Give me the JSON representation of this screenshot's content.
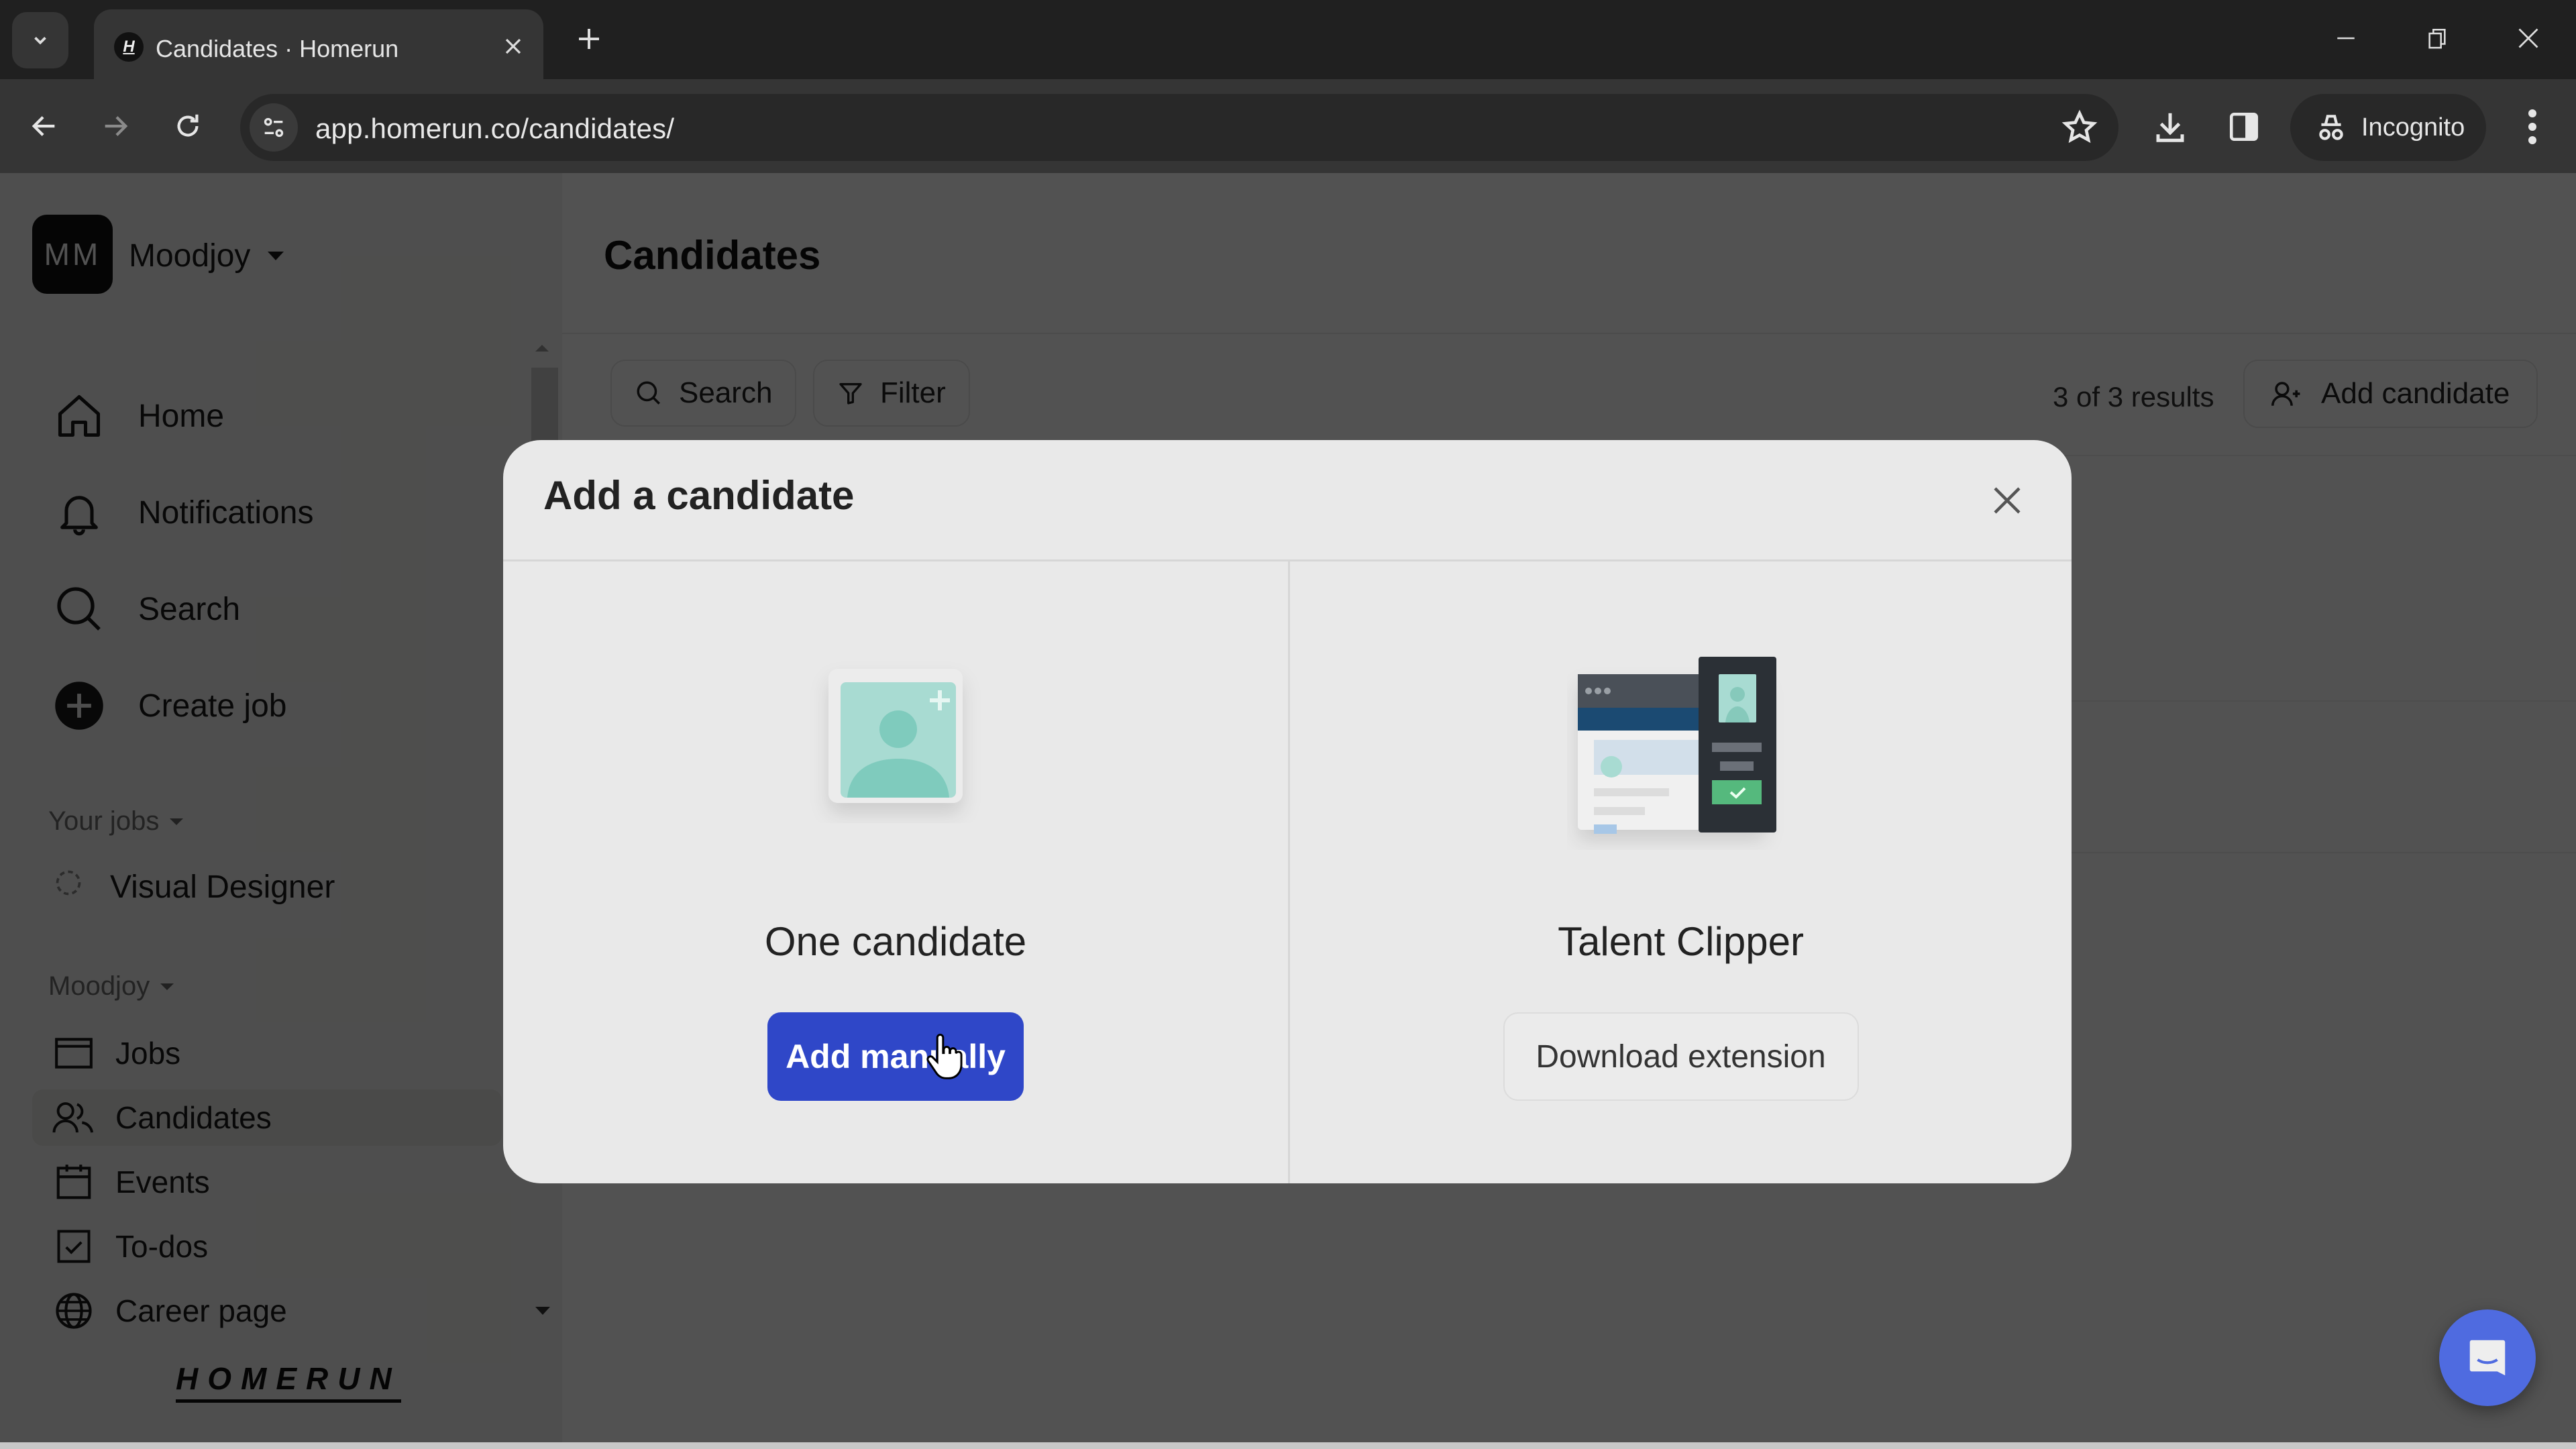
{
  "browser": {
    "tab_title": "Candidates · Homerun",
    "tab_favicon_letter": "H",
    "url": "app.homerun.co/candidates/",
    "incognito_label": "Incognito"
  },
  "sidebar": {
    "workspace_initials": "MM",
    "workspace_name": "Moodjoy",
    "main_nav": [
      {
        "label": "Home",
        "icon": "home-icon"
      },
      {
        "label": "Notifications",
        "icon": "bell-icon"
      },
      {
        "label": "Search",
        "icon": "search-icon"
      },
      {
        "label": "Create job",
        "icon": "plus-circle-icon"
      }
    ],
    "your_jobs_label": "Your jobs",
    "jobs": [
      {
        "label": "Visual Designer",
        "icon": "dashed-circle-icon"
      }
    ],
    "org_section_label": "Moodjoy",
    "org_nav": [
      {
        "label": "Jobs",
        "icon": "card-icon",
        "active": false
      },
      {
        "label": "Candidates",
        "icon": "users-icon",
        "active": true
      },
      {
        "label": "Events",
        "icon": "calendar-icon",
        "active": false
      },
      {
        "label": "To-dos",
        "icon": "checkbox-icon",
        "active": false
      },
      {
        "label": "Career page",
        "icon": "globe-icon",
        "active": false
      }
    ],
    "brand": "HOMERUN"
  },
  "main": {
    "page_title": "Candidates",
    "search_label": "Search",
    "filter_label": "Filter",
    "results_text": "3 of 3 results",
    "add_candidate_label": "Add candidate"
  },
  "modal": {
    "title": "Add a candidate",
    "options": [
      {
        "title": "One candidate",
        "button_label": "Add manually",
        "button_style": "primary"
      },
      {
        "title": "Talent Clipper",
        "button_label": "Download extension",
        "button_style": "secondary"
      }
    ]
  },
  "colors": {
    "primary_button": "#2f47c8",
    "chat_fab": "#4f6be0",
    "illustration_teal": "#7fcbbd",
    "illustration_navy": "#1b4a72",
    "illustration_green": "#55b97d"
  }
}
